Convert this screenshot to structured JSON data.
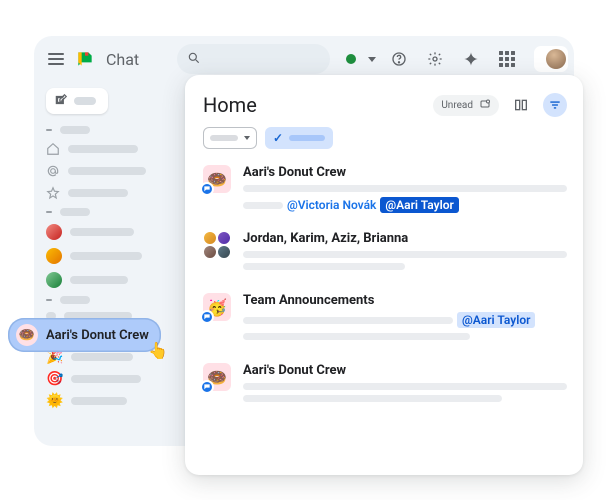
{
  "app": {
    "title": "Chat"
  },
  "header": {
    "unread_label": "Unread"
  },
  "panel": {
    "title": "Home"
  },
  "feed": [
    {
      "title": "Aari's Donut Crew",
      "mention_link": "@Victoria Novák",
      "mention_pill": "@Aari Taylor"
    },
    {
      "title": "Jordan, Karim, Aziz, Brianna"
    },
    {
      "title": "Team Announcements",
      "mention_pill": "@Aari Taylor"
    },
    {
      "title": "Aari's Donut Crew"
    }
  ],
  "tooltip": {
    "label": "Aari's Donut Crew"
  }
}
